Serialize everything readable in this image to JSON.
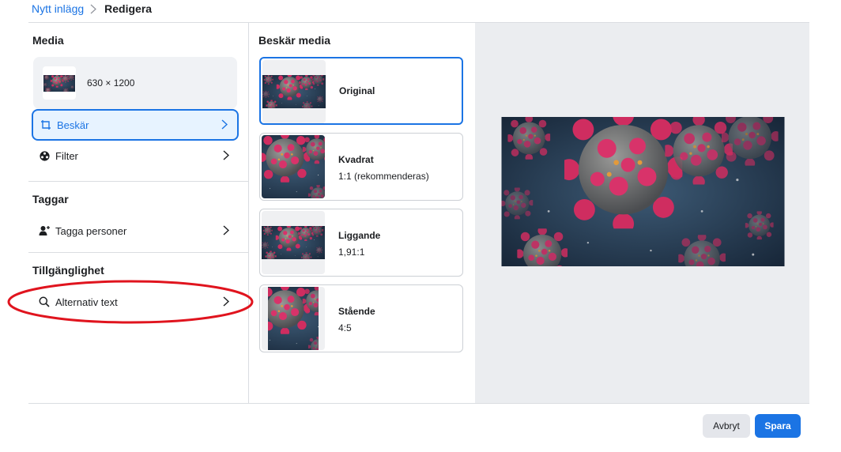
{
  "breadcrumb": {
    "parent": "Nytt inlägg",
    "current": "Redigera"
  },
  "left": {
    "media_title": "Media",
    "media_dims": "630 × 1200",
    "crop_label": "Beskär",
    "filter_label": "Filter",
    "tags_title": "Taggar",
    "tag_people_label": "Tagga personer",
    "accessibility_title": "Tillgänglighet",
    "alt_text_label": "Alternativ text"
  },
  "crop": {
    "title": "Beskär media",
    "options": [
      {
        "name": "Original",
        "ratio": ""
      },
      {
        "name": "Kvadrat",
        "ratio": "1:1 (rekommenderas)"
      },
      {
        "name": "Liggande",
        "ratio": "1,91:1"
      },
      {
        "name": "Stående",
        "ratio": "4:5"
      }
    ]
  },
  "buttons": {
    "cancel": "Avbryt",
    "save": "Spara"
  },
  "colors": {
    "accent": "#1b74e4",
    "selected_bg": "#e7f3ff",
    "annotation": "#e0141e"
  }
}
